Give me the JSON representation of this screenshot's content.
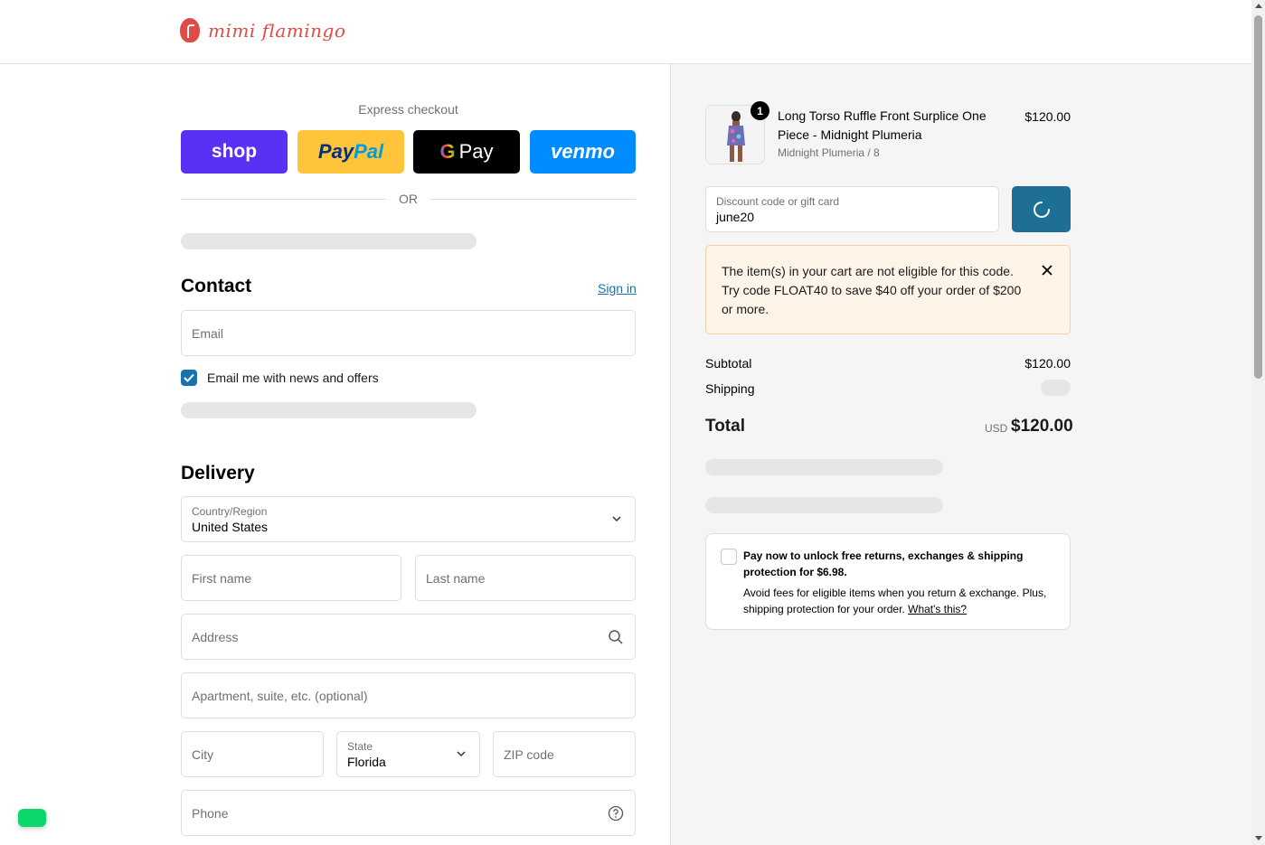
{
  "brand": {
    "name": "mimi flamingo"
  },
  "express": {
    "label": "Express checkout",
    "shop": "shop",
    "paypal_a": "Pay",
    "paypal_b": "Pal",
    "gpay_g": "G",
    "gpay_text": "Pay",
    "venmo": "venmo",
    "or": "OR"
  },
  "contact": {
    "heading": "Contact",
    "sign_in": "Sign in",
    "email_placeholder": "Email",
    "news_label": "Email me with news and offers",
    "news_checked": true
  },
  "delivery": {
    "heading": "Delivery",
    "country_label": "Country/Region",
    "country_value": "United States",
    "first_name": "First name",
    "last_name": "Last name",
    "address": "Address",
    "apartment": "Apartment, suite, etc. (optional)",
    "city": "City",
    "state_label": "State",
    "state_value": "Florida",
    "zip": "ZIP code",
    "phone": "Phone"
  },
  "summary": {
    "product": {
      "title": "Long Torso Ruffle Front Surplice One Piece - Midnight Plumeria",
      "variant": "Midnight Plumeria / 8",
      "price": "$120.00",
      "quantity": "1"
    },
    "discount": {
      "label": "Discount code or gift card",
      "value": "june20"
    },
    "notice": "The item(s) in your cart are not eligible for this code. Try code FLOAT40 to save $40 off your order of $200 or more.",
    "subtotal_label": "Subtotal",
    "subtotal_value": "$120.00",
    "shipping_label": "Shipping",
    "total_label": "Total",
    "total_currency": "USD",
    "total_value": "$120.00",
    "protection": {
      "title": "Pay now to unlock free returns, exchanges & shipping protection for $6.98.",
      "desc": "Avoid fees for eligible items when you return & exchange. Plus, shipping protection for your order.",
      "link": "What's this?"
    }
  },
  "colors": {
    "accent": "#1773b0",
    "apply_button": "#1d6f96",
    "brand": "#e04b45",
    "notice_bg": "#fff4e8",
    "shop": "#5a31f4",
    "paypal": "#ffc439",
    "venmo": "#008cff"
  }
}
